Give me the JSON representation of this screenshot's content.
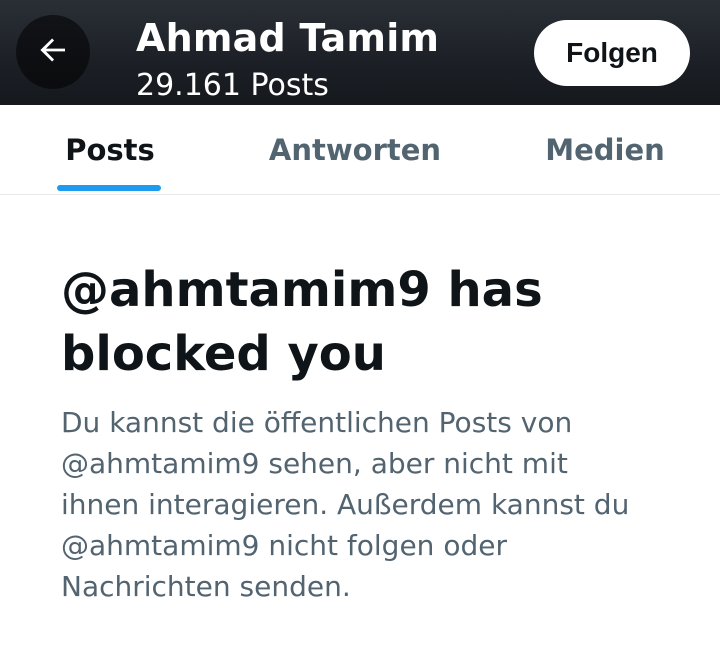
{
  "header": {
    "name": "Ahmad Tamim",
    "post_count": "29.161 Posts",
    "follow_label": "Folgen",
    "back_icon": "arrow-left-icon"
  },
  "tabs": [
    {
      "label": "Posts",
      "active": true
    },
    {
      "label": "Antworten",
      "active": false
    },
    {
      "label": "Medien",
      "active": false
    }
  ],
  "blocked": {
    "title": "@ahmtamim9 has blocked you",
    "description": "Du kannst die öffentlichen Posts von @ahmtamim9 sehen, aber nicht mit ihnen interagieren. Außerdem kannst du @ahmtamim9 nicht folgen oder Nachrichten senden."
  },
  "colors": {
    "accent": "#1d9bf0",
    "text_primary": "#0f1419",
    "text_secondary": "#536471",
    "header_bg": "#1c2026"
  }
}
